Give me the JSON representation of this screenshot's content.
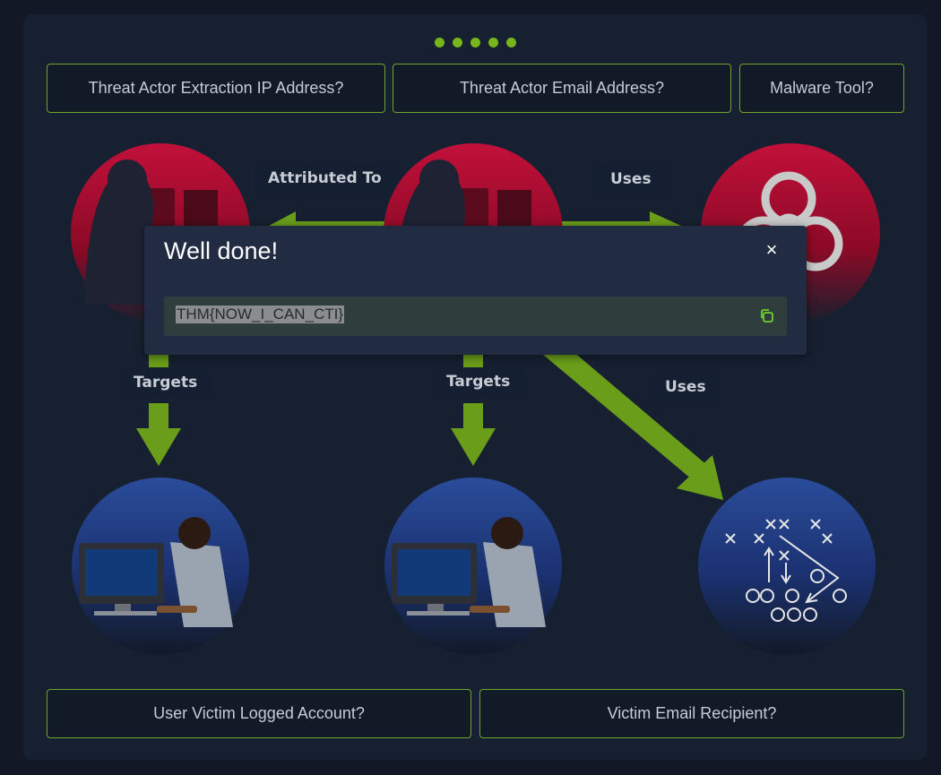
{
  "questions": {
    "extraction_ip": "Threat Actor Extraction IP Address?",
    "email_address": "Threat Actor Email Address?",
    "malware_tool": "Malware Tool?",
    "logged_account": "User Victim Logged Account?",
    "email_recipient": "Victim Email Recipient?"
  },
  "relations": {
    "attributed_to": "Attributed To",
    "uses_top": "Uses",
    "uses_diag": "Uses",
    "targets_left": "Targets",
    "targets_mid": "Targets"
  },
  "progress_dots": 5,
  "modal": {
    "title": "Well done!",
    "close_symbol": "×",
    "flag": "THM{NOW_I_CAN_CTI}",
    "copy_icon": "copy-icon"
  },
  "colors": {
    "accent_green": "#78b51c",
    "threat_red": "#9a0f2e",
    "victim_blue": "#1f3a7a"
  }
}
